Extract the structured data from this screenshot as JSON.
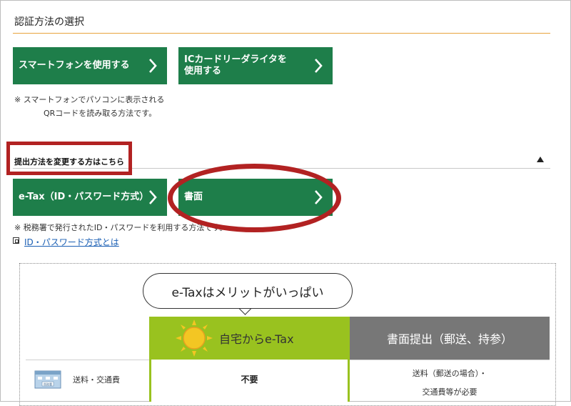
{
  "section": {
    "title": "認証方法の選択"
  },
  "auth_buttons": [
    {
      "label_line1": "スマートフォンを使用する",
      "label_line2": ""
    },
    {
      "label_line1": "ICカードリーダライタを",
      "label_line2": "使用する"
    }
  ],
  "auth_note": {
    "line1": "※ スマートフォンでパソコンに表示される",
    "line2": "QRコードを読み取る方法です。"
  },
  "submit": {
    "title": "提出方法を変更する方はこちら",
    "buttons": [
      {
        "label": "e-Tax（ID・パスワード方式）"
      },
      {
        "label": "書面"
      }
    ],
    "note": "※ 税務署で発行されたID・パスワードを利用する方法です。",
    "link": "ID・パスワード方式とは"
  },
  "comparison": {
    "bubble": "e-Taxはメリットがいっぱい",
    "etax_header": "自宅からe-Tax",
    "paper_header": "書面提出（郵送、持参）",
    "row_label": "送料・交通費",
    "building_sign": "税務署",
    "etax_value": "不要",
    "paper_value_line1": "送料（郵送の場合）・",
    "paper_value_line2": "交通費等が必要"
  },
  "colors": {
    "button_green": "#1e7e4a",
    "etax_green": "#99c21f",
    "paper_grey": "#777777",
    "highlight_red": "#b22222",
    "rule_orange": "#e8a33d",
    "link_blue": "#1a5fb4"
  }
}
